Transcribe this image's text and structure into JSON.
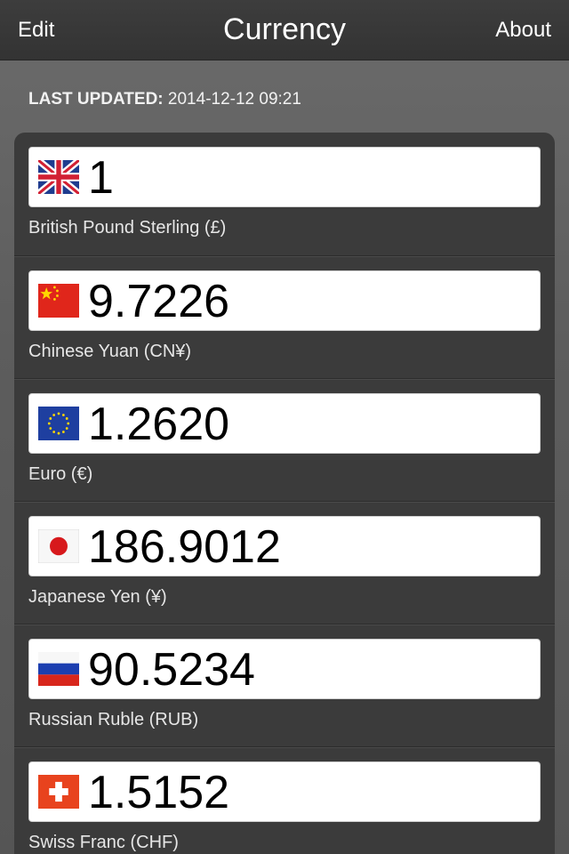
{
  "navbar": {
    "title": "Currency",
    "left_button": "Edit",
    "right_button": "About"
  },
  "last_updated": {
    "label": "LAST UPDATED:",
    "value": "2014-12-12 09:21"
  },
  "currencies": [
    {
      "amount": "1",
      "name": "British Pound Sterling (£)",
      "flag": "uk-flag-icon"
    },
    {
      "amount": "9.7226",
      "name": "Chinese Yuan (CN¥)",
      "flag": "china-flag-icon"
    },
    {
      "amount": "1.2620",
      "name": "Euro (€)",
      "flag": "eu-flag-icon"
    },
    {
      "amount": "186.9012",
      "name": "Japanese Yen (¥)",
      "flag": "japan-flag-icon"
    },
    {
      "amount": "90.5234",
      "name": "Russian Ruble (RUB)",
      "flag": "russia-flag-icon"
    },
    {
      "amount": "1.5152",
      "name": "Swiss Franc (CHF)",
      "flag": "switzerland-flag-icon"
    }
  ]
}
